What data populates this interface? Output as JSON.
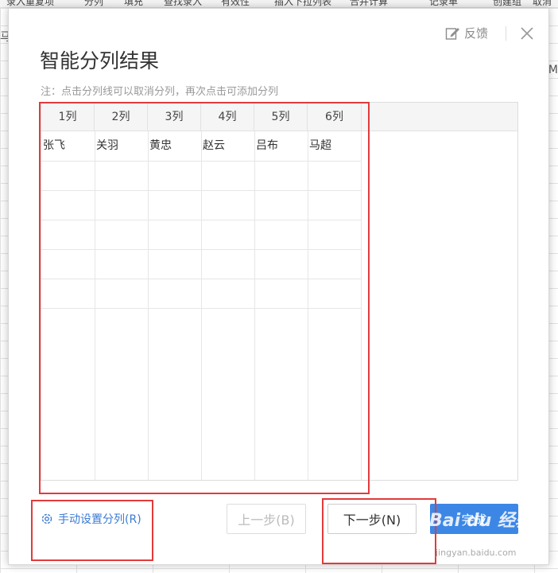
{
  "background": {
    "toolbar_items": [
      "录入重复项",
      "分列",
      "填充",
      "查找录入",
      "有效性",
      "插入下拉列表",
      "合并计算",
      "记录单",
      "创建组",
      "取消"
    ],
    "left_fragment": "马",
    "right_fragment": "M"
  },
  "dialog": {
    "title": "智能分列结果",
    "note": "注：点击分列线可以取消分列，再次点击可添加分列",
    "feedback_label": "反馈",
    "columns": [
      "1列",
      "2列",
      "3列",
      "4列",
      "5列",
      "6列"
    ],
    "rows": [
      [
        "张飞",
        "关羽",
        "黄忠",
        "赵云",
        "吕布",
        "马超"
      ]
    ],
    "manual_split_label": "手动设置分列(R)",
    "prev_label": "上一步(B)",
    "next_label": "下一步(N)",
    "done_label": "完成"
  },
  "watermark": {
    "brand": "Bai du 经验",
    "url": "jingyan.baidu.com"
  },
  "colors": {
    "accent": "#3c87e6",
    "annotation": "#e23b3b"
  }
}
